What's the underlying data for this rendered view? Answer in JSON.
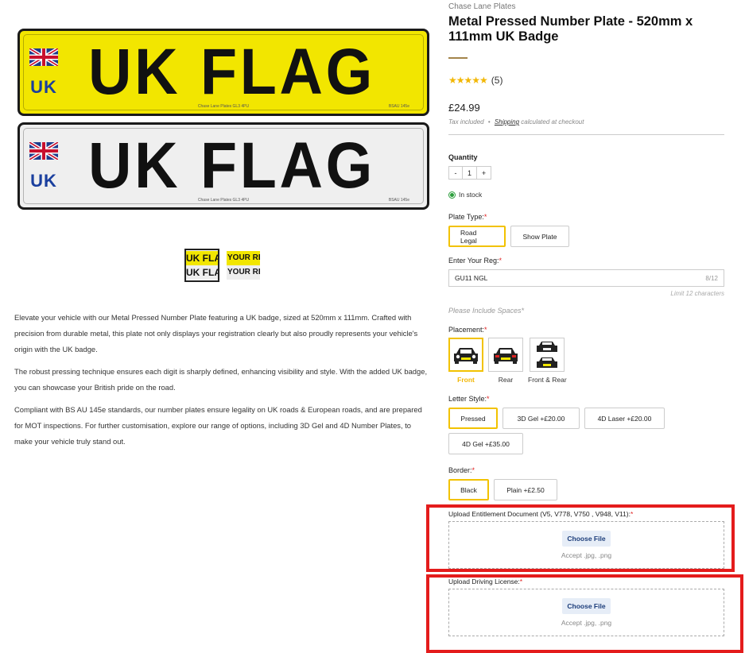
{
  "gallery": {
    "plates": [
      {
        "style": "yellow",
        "reg": "UK FLAG",
        "badge": "UK",
        "maker": "Chase Lane Plates GL3 4PU",
        "maker_right": "BSAU 145e"
      },
      {
        "style": "white",
        "reg": "UK FLAG",
        "badge": "UK",
        "maker": "Chase Lane Plates GL3 4PU",
        "maker_right": "BSAU 145e"
      }
    ],
    "thumbnails": [
      {
        "top": "UK FLA",
        "bottom": "UK FLA",
        "selected": true
      },
      {
        "top": "YOUR RE",
        "bottom": "YOUR RE",
        "selected": false
      }
    ]
  },
  "description": [
    "Elevate your vehicle with our Metal Pressed Number Plate featuring a UK badge, sized at 520mm x 111mm. Crafted with precision from durable metal, this plate not only displays your registration clearly but also proudly represents your vehicle's origin with the UK badge.",
    "The robust pressing technique ensures each digit is sharply defined, enhancing visibility and style. With the added UK badge, you can showcase your British pride on the road.",
    "Compliant with BS AU 145e standards, our number plates ensure legality on UK roads & European roads, and are prepared for MOT inspections. For further customisation, explore our range of options, including 3D Gel and 4D Number Plates, to make your vehicle truly stand out."
  ],
  "product": {
    "vendor": "Chase Lane Plates",
    "title": "Metal Pressed Number Plate - 520mm x 111mm UK Badge",
    "stars": "★★★★★",
    "review_count": "(5)",
    "price": "£24.99",
    "tax_included": "Tax included",
    "bullet": "•",
    "shipping": "Shipping",
    "shipping_suffix": "calculated at checkout"
  },
  "quantity": {
    "label": "Quantity",
    "minus": "-",
    "value": "1",
    "plus": "+"
  },
  "stock": {
    "label": "In stock"
  },
  "plate_type": {
    "label": "Plate Type:",
    "required": "*",
    "options": [
      "Road Legal",
      "Show Plate"
    ],
    "selected": "Road Legal"
  },
  "registration": {
    "label": "Enter Your Reg:",
    "required": "*",
    "value": "GU11 NGL",
    "count": "8/12",
    "limit": "Limit 12 characters",
    "hint": "Please Include Spaces*"
  },
  "placement": {
    "label": "Placement:",
    "required": "*",
    "options": [
      "Front",
      "Rear",
      "Front & Rear"
    ],
    "selected": "Front"
  },
  "letter_style": {
    "label": "Letter Style:",
    "required": "*",
    "options": [
      "Pressed",
      "3D Gel +£20.00",
      "4D Laser +£20.00",
      "4D Gel +£35.00"
    ],
    "selected": "Pressed"
  },
  "border": {
    "label": "Border:",
    "required": "*",
    "options": [
      "Black",
      "Plain +£2.50"
    ],
    "selected": "Black"
  },
  "uploads": [
    {
      "label": "Upload Entitlement Document (V5, V778, V750 , V948, V11):",
      "required": "*",
      "button": "Choose File",
      "accept": "Accept .jpg, .png"
    },
    {
      "label": "Upload Driving License:",
      "required": "*",
      "button": "Choose File",
      "accept": "Accept .jpg, .png"
    }
  ],
  "colors": {
    "accent": "#f2c200",
    "highlight_box": "#e41c1c",
    "plate_yellow": "#f2e600",
    "badge_blue": "#1a3f9e",
    "in_stock": "#2a9d3a"
  }
}
